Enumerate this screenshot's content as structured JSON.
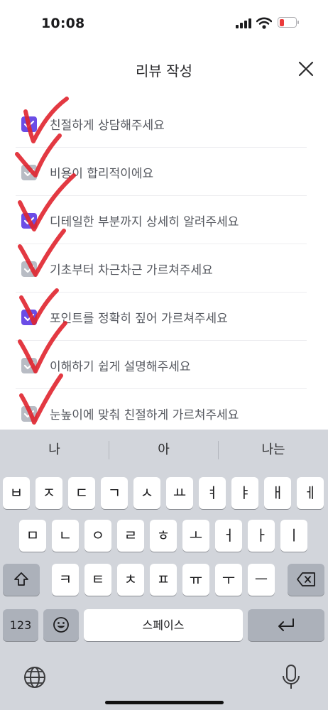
{
  "status_bar": {
    "time": "10:08"
  },
  "header": {
    "title": "리뷰 작성"
  },
  "review_options": [
    {
      "label": "친절하게 상담해주세요",
      "checked": true
    },
    {
      "label": "비용이 합리적이에요",
      "checked": false
    },
    {
      "label": "디테일한 부분까지 상세히 알려주세요",
      "checked": true
    },
    {
      "label": "기초부터 차근차근 가르쳐주세요",
      "checked": false
    },
    {
      "label": "포인트를 정확히 짚어 가르쳐주세요",
      "checked": true
    },
    {
      "label": "이해하기 쉽게 설명해주세요",
      "checked": false
    },
    {
      "label": "눈높이에 맞춰 친절하게 가르쳐주세요",
      "checked": false
    }
  ],
  "keyboard": {
    "suggestions": [
      "나",
      "아",
      "나는"
    ],
    "row1": [
      "ㅂ",
      "ㅈ",
      "ㄷ",
      "ㄱ",
      "ㅅ",
      "ㅛ",
      "ㅕ",
      "ㅑ",
      "ㅐ",
      "ㅔ"
    ],
    "row2": [
      "ㅁ",
      "ㄴ",
      "ㅇ",
      "ㄹ",
      "ㅎ",
      "ㅗ",
      "ㅓ",
      "ㅏ",
      "ㅣ"
    ],
    "row3": [
      "ㅋ",
      "ㅌ",
      "ㅊ",
      "ㅍ",
      "ㅠ",
      "ㅜ",
      "ㅡ"
    ],
    "numbers_label": "123",
    "space_label": "스페이스"
  },
  "colors": {
    "checkbox_checked": "#6b4de6",
    "checkbox_unchecked": "#b8bcc4",
    "annotation_marks": "#e0242e",
    "keyboard_bg": "#d2d5db"
  },
  "icons": [
    "signal-icon",
    "wifi-icon",
    "battery-low-icon",
    "close-icon",
    "checkmark-icon",
    "shift-icon",
    "backspace-icon",
    "emoji-icon",
    "return-icon",
    "globe-icon",
    "microphone-icon"
  ]
}
